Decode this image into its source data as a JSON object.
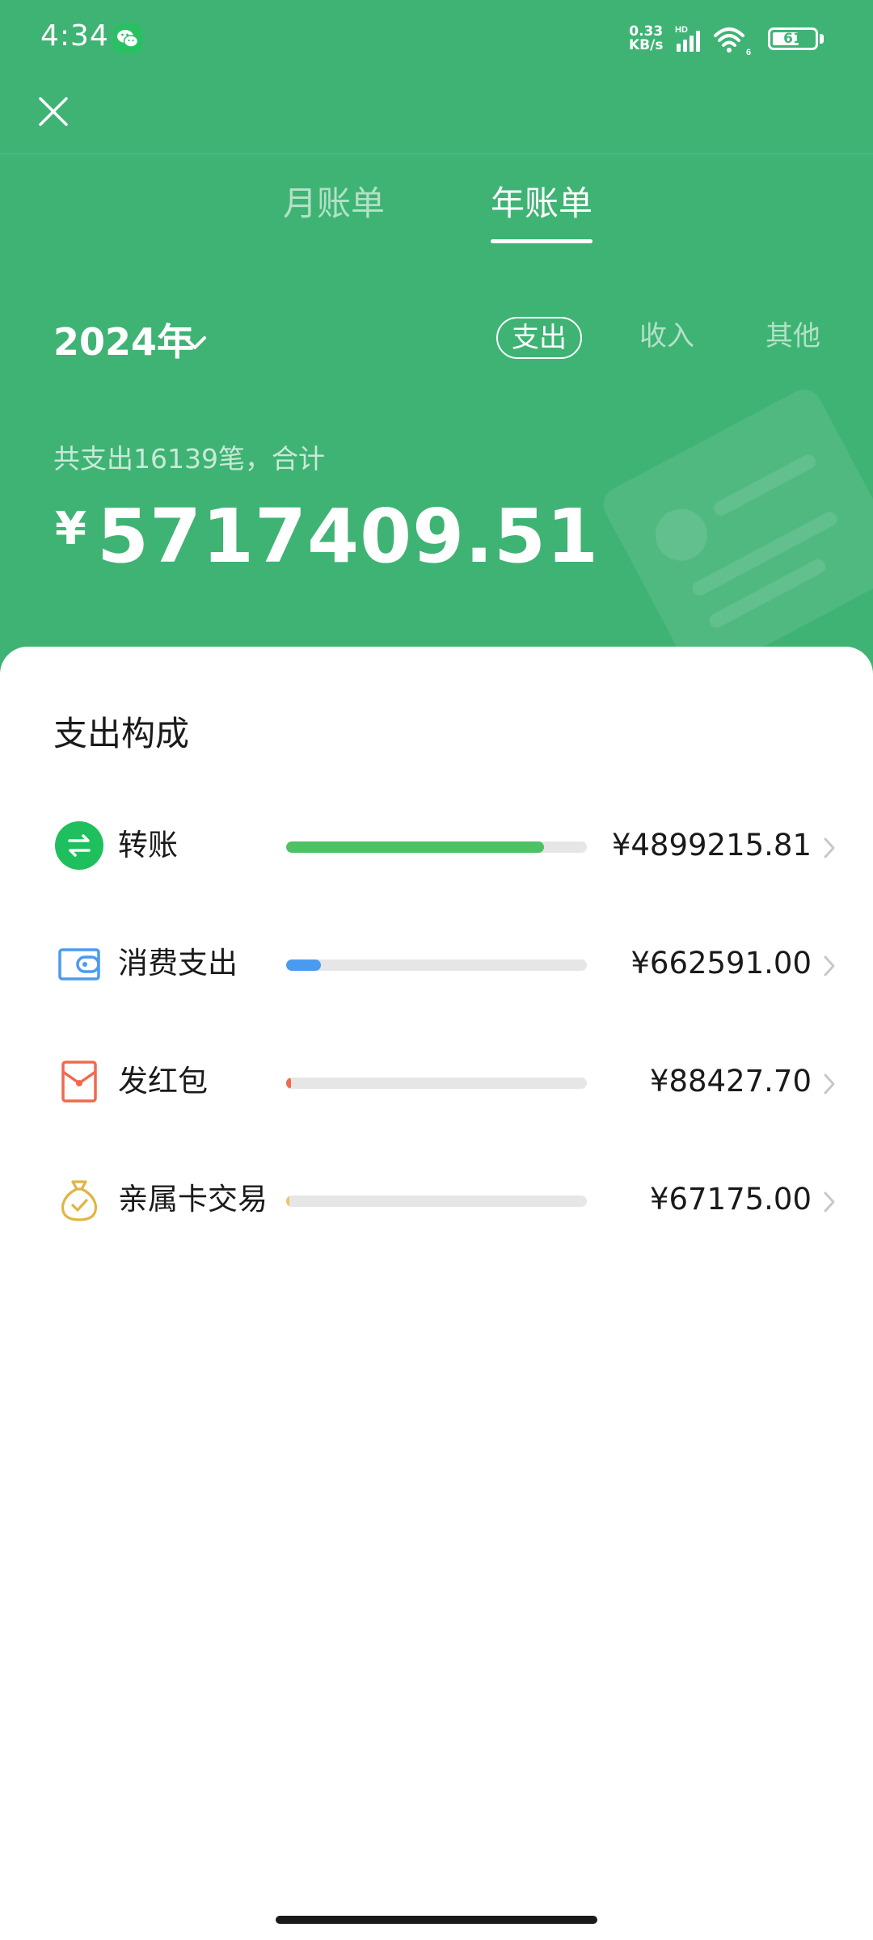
{
  "status_bar": {
    "time": "4:34",
    "net_speed_value": "0.33",
    "net_speed_unit": "KB/s",
    "signal_label": "HD",
    "wifi_label": "6",
    "battery": "61"
  },
  "tabs": [
    {
      "label": "月账单",
      "active": false
    },
    {
      "label": "年账单",
      "active": true
    }
  ],
  "year_selector": "2024年",
  "filters": [
    {
      "label": "支出",
      "active": true
    },
    {
      "label": "收入",
      "active": false
    },
    {
      "label": "其他",
      "active": false
    }
  ],
  "summary": {
    "text": "共支出16139笔，合计",
    "currency_symbol": "¥",
    "total": "5717409.51"
  },
  "breakdown": {
    "title": "支出构成",
    "items": [
      {
        "icon": "transfer-icon",
        "label": "转账",
        "value": "¥4899215.81",
        "share": 0.857,
        "color": "#4cc264"
      },
      {
        "icon": "wallet-icon",
        "label": "消费支出",
        "value": "¥662591.00",
        "share": 0.116,
        "color": "#4a9af0"
      },
      {
        "icon": "red-packet-icon",
        "label": "发红包",
        "value": "¥88427.70",
        "share": 0.015,
        "color": "#f06a4f"
      },
      {
        "icon": "money-bag-icon",
        "label": "亲属卡交易",
        "value": "¥67175.00",
        "share": 0.012,
        "color": "#f2c36b"
      }
    ]
  },
  "colors": {
    "header_green": "#3fb374",
    "text_dark": "#1a1a1a",
    "track_grey": "#e6e6e6"
  }
}
